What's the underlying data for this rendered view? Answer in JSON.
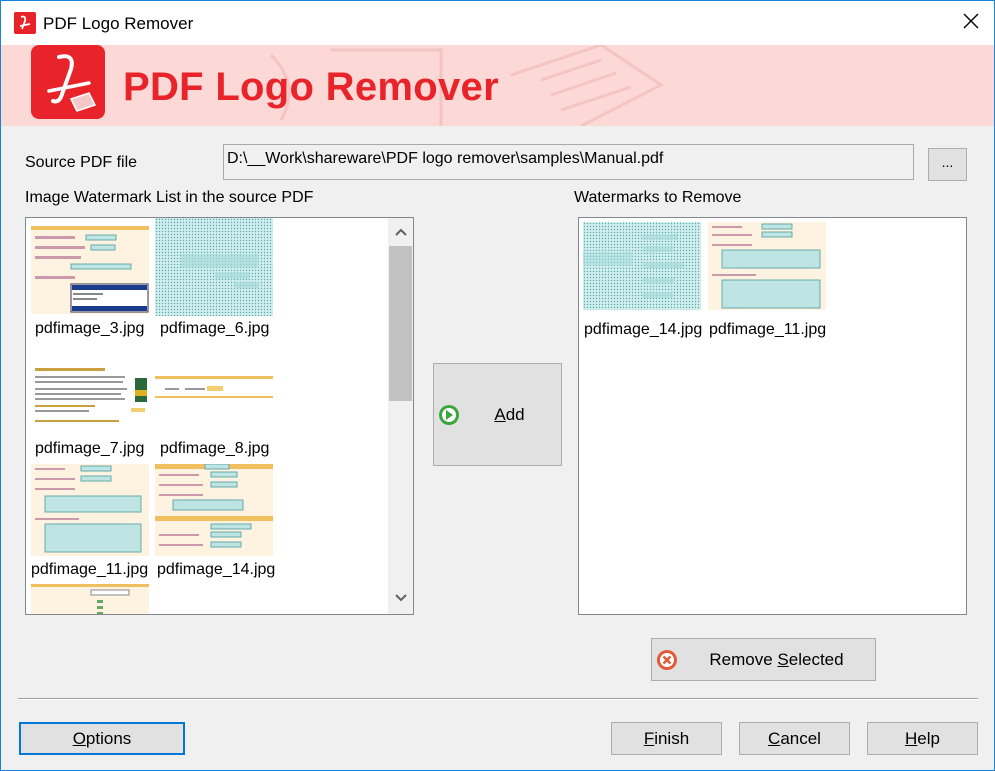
{
  "window": {
    "title": "PDF Logo Remover"
  },
  "banner": {
    "title": "PDF Logo Remover"
  },
  "source": {
    "label": "Source PDF file",
    "path": "D:\\__Work\\shareware\\PDF logo remover\\samples\\Manual.pdf",
    "browse_label": "..."
  },
  "left_list": {
    "label": "Image Watermark List in the source PDF",
    "items": [
      {
        "name": "pdfimage_3.jpg"
      },
      {
        "name": "pdfimage_6.jpg"
      },
      {
        "name": "pdfimage_7.jpg"
      },
      {
        "name": "pdfimage_8.jpg"
      },
      {
        "name": "pdfimage_11.jpg"
      },
      {
        "name": "pdfimage_14.jpg"
      }
    ]
  },
  "right_list": {
    "label": "Watermarks to Remove",
    "items": [
      {
        "name": "pdfimage_14.jpg"
      },
      {
        "name": "pdfimage_11.jpg"
      }
    ]
  },
  "buttons": {
    "add": {
      "pre": "",
      "key": "A",
      "post": "dd"
    },
    "remove": {
      "pre": "Remove ",
      "key": "S",
      "post": "elected"
    },
    "options": {
      "pre": "",
      "key": "O",
      "post": "ptions"
    },
    "finish": {
      "pre": "",
      "key": "F",
      "post": "inish"
    },
    "cancel": {
      "pre": "",
      "key": "C",
      "post": "ancel"
    },
    "help": {
      "pre": "",
      "key": "H",
      "post": "elp"
    }
  },
  "colors": {
    "accent": "#e8232a",
    "banner_bg": "#fcd8d6",
    "focus": "#0078d7",
    "add_icon": "#3aa53a",
    "remove_icon": "#e05a3a"
  },
  "icons": {
    "app": "pdf-icon",
    "close": "close-icon",
    "add": "green-arrow-icon",
    "remove": "red-x-icon"
  }
}
